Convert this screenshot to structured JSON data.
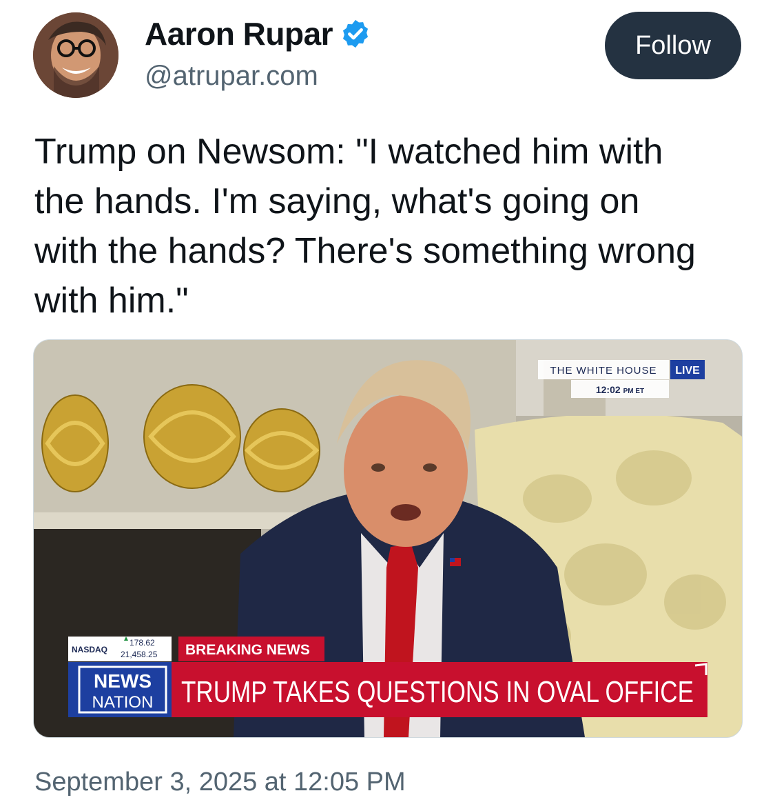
{
  "author": {
    "display_name": "Aaron Rupar",
    "handle": "@atrupar.com",
    "verified_icon": "verified-badge-icon",
    "avatar": "profile-photo"
  },
  "follow_button": {
    "label": "Follow"
  },
  "tweet": {
    "text": "Trump on Newsom: \"I watched him with the hands. I'm saying, what's going on with the hands? There's something wrong with him.\"",
    "timestamp": "September 3, 2025 at 12:05 PM"
  },
  "media": {
    "type": "video-still",
    "location_tag": "THE WHITE HOUSE",
    "live_tag": "LIVE",
    "clock_time": "12:02",
    "clock_suffix": "PM ET",
    "ticker_label": "NASDAQ",
    "ticker_change": "178.62",
    "ticker_value": "21,458.25",
    "breaking_label": "BREAKING NEWS",
    "headline": "TRUMP TAKES QUESTIONS IN OVAL OFFICE",
    "network_logo_top": "NEWS",
    "network_logo_bottom": "NATION"
  },
  "colors": {
    "follow_bg": "#243241",
    "verified": "#1d9bf0",
    "secondary_text": "#536471",
    "breaking_red": "#c8102e",
    "network_blue": "#1d3fa0"
  }
}
